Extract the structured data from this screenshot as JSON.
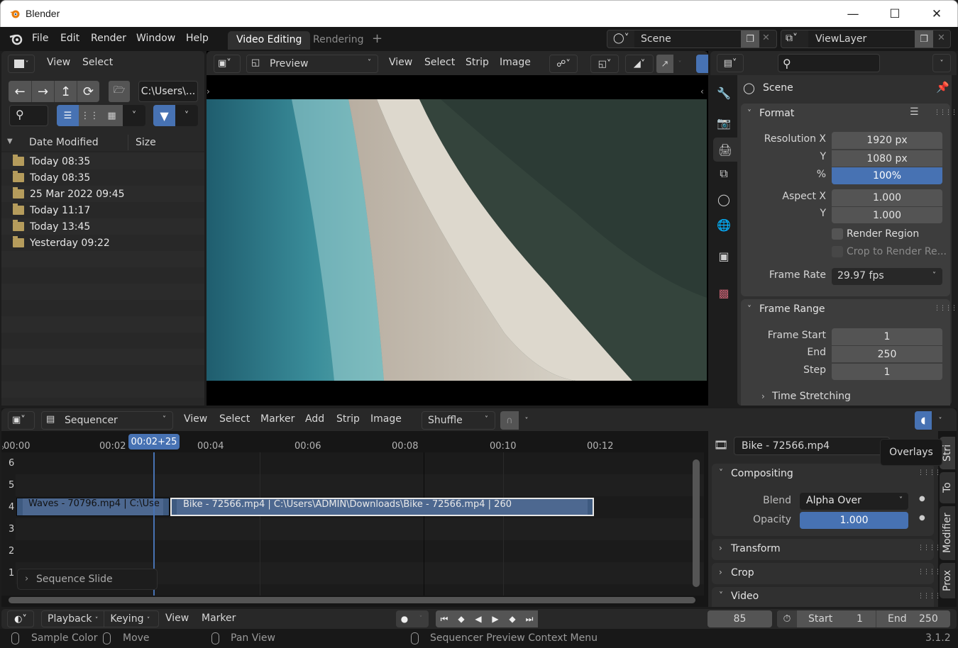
{
  "window": {
    "title": "Blender",
    "controls": [
      "minimize",
      "maximize",
      "close"
    ]
  },
  "topbar": {
    "menus": [
      "File",
      "Edit",
      "Render",
      "Window",
      "Help"
    ],
    "workspaces": [
      {
        "label": "Video Editing",
        "active": true
      },
      {
        "label": "Rendering",
        "active": false
      }
    ],
    "add_workspace": "+",
    "scene": "Scene",
    "view_layer": "ViewLayer"
  },
  "file_browser": {
    "header_menus": [
      "View",
      "Select"
    ],
    "path": "C:\\Users\\...",
    "columns": [
      "Date Modified",
      "Size"
    ],
    "items": [
      {
        "date": "Today 08:35",
        "size": ""
      },
      {
        "date": "Today 08:35",
        "size": ""
      },
      {
        "date": "25 Mar 2022 09:45",
        "size": ""
      },
      {
        "date": "Today 11:17",
        "size": ""
      },
      {
        "date": "Today 13:45",
        "size": ""
      },
      {
        "date": "Yesterday 09:22",
        "size": ""
      }
    ]
  },
  "preview": {
    "mode": "Preview",
    "menus": [
      "View",
      "Select",
      "Strip",
      "Image"
    ]
  },
  "properties": {
    "context": "Scene",
    "format": {
      "title": "Format",
      "resolution_x_label": "Resolution X",
      "resolution_x": "1920 px",
      "resolution_y_label": "Y",
      "resolution_y": "1080 px",
      "percent_label": "%",
      "percent": "100%",
      "aspect_x_label": "Aspect X",
      "aspect_x": "1.000",
      "aspect_y_label": "Y",
      "aspect_y": "1.000",
      "render_region": "Render Region",
      "crop_region": "Crop to Render Re...",
      "frame_rate_label": "Frame Rate",
      "frame_rate": "29.97 fps"
    },
    "frame_range": {
      "title": "Frame Range",
      "start_label": "Frame Start",
      "start": "1",
      "end_label": "End",
      "end": "250",
      "step_label": "Step",
      "step": "1",
      "time_stretching": "Time Stretching"
    }
  },
  "sequencer": {
    "mode": "Sequencer",
    "menus": [
      "View",
      "Select",
      "Marker",
      "Add",
      "Strip",
      "Image"
    ],
    "overlap_mode": "Shuffle",
    "ticks": [
      "00:00",
      "00:02",
      "00:04",
      "00:06",
      "00:08",
      "00:10",
      "00:12"
    ],
    "current_time": "00:02+25",
    "channels": [
      "6",
      "5",
      "4",
      "3",
      "2",
      "1"
    ],
    "strips": [
      {
        "label": "Waves - 70796.mp4 | C:\\Use",
        "channel": 4,
        "selected": false
      },
      {
        "label": "Bike - 72566.mp4 | C:\\Users\\ADMIN\\Downloads\\Bike - 72566.mp4 | 260",
        "channel": 4,
        "selected": true
      }
    ],
    "last_op": "Sequence Slide"
  },
  "strip_panel": {
    "strip_name": "Bike - 72566.mp4",
    "tooltip": "Overlays",
    "compositing": {
      "title": "Compositing",
      "blend_label": "Blend",
      "blend": "Alpha Over",
      "opacity_label": "Opacity",
      "opacity": "1.000"
    },
    "sections": [
      "Transform",
      "Crop",
      "Video"
    ],
    "tabs": [
      "Stri",
      "To",
      "Modifier",
      "Prox"
    ]
  },
  "timeline": {
    "menus": [
      "Playback",
      "Keying",
      "View",
      "Marker"
    ],
    "current_frame": "85",
    "start_label": "Start",
    "start": "1",
    "end_label": "End",
    "end": "250"
  },
  "statusbar": {
    "hints": [
      "Sample Color",
      "Move",
      "Pan View",
      "Sequencer Preview Context Menu"
    ],
    "version": "3.1.2"
  }
}
